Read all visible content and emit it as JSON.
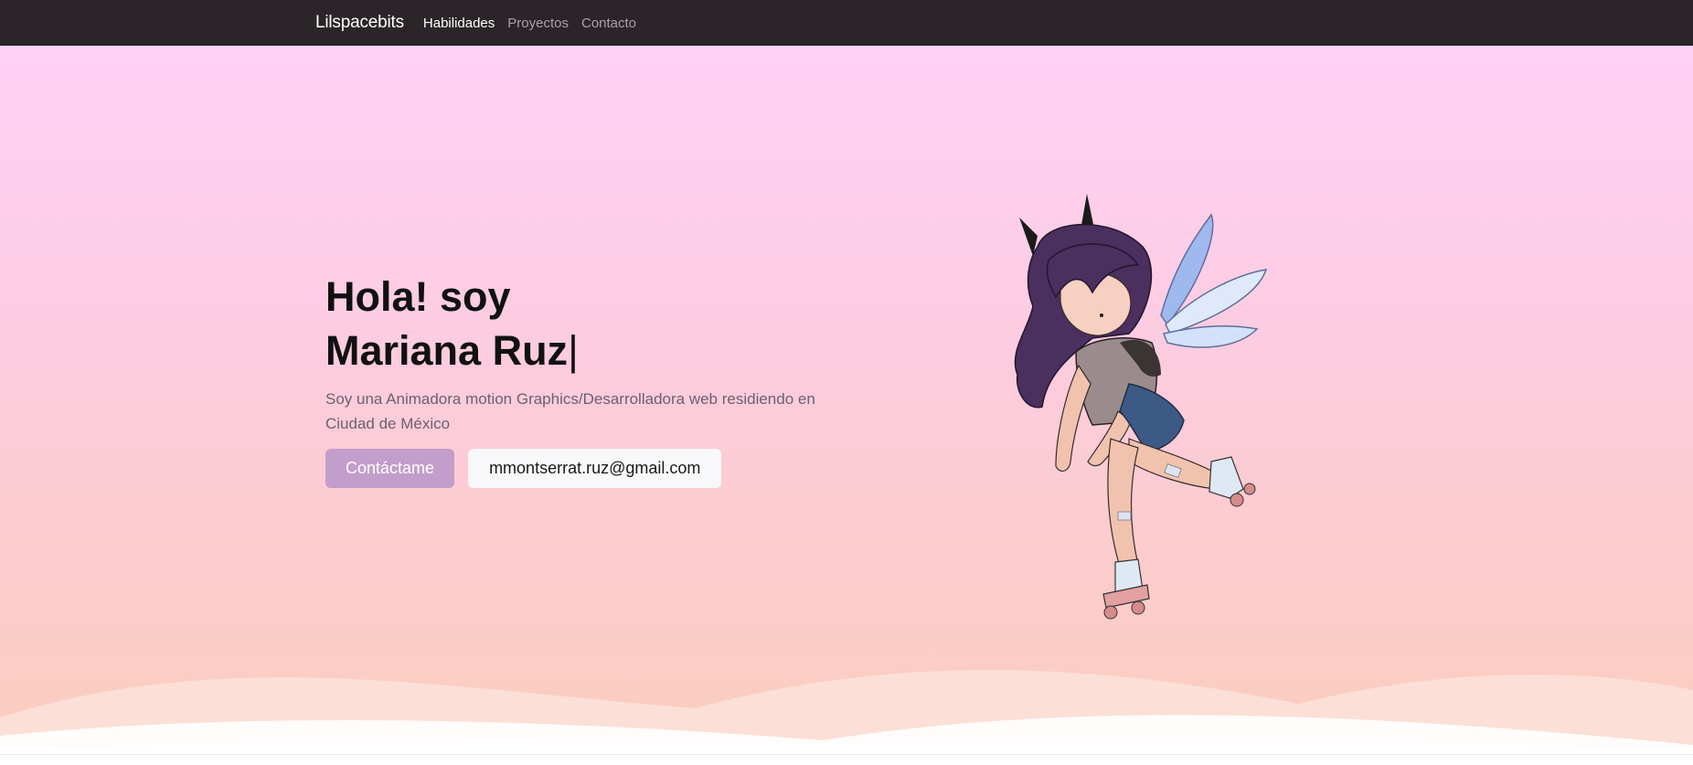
{
  "navbar": {
    "brand": "Lilspacebits",
    "links": [
      {
        "label": "Habilidades",
        "active": true
      },
      {
        "label": "Proyectos",
        "active": false
      },
      {
        "label": "Contacto",
        "active": false
      }
    ]
  },
  "hero": {
    "title_line1": "Hola! soy",
    "title_line2": "Mariana Ruz",
    "cursor": "|",
    "description": "Soy una Animadora motion Graphics/Desarrolladora web residiendo en Ciudad de México",
    "primary_button": "Contáctame",
    "email_button": "mmontserrat.ruz@gmail.com"
  },
  "colors": {
    "navbar_bg": "#2b2529",
    "hero_gradient_top": "#ffd1f7",
    "hero_gradient_bottom": "#fbcdbd",
    "primary_button": "#c39dcb"
  },
  "illustration": {
    "subject": "fairy-girl-roller-skates-illustration"
  }
}
